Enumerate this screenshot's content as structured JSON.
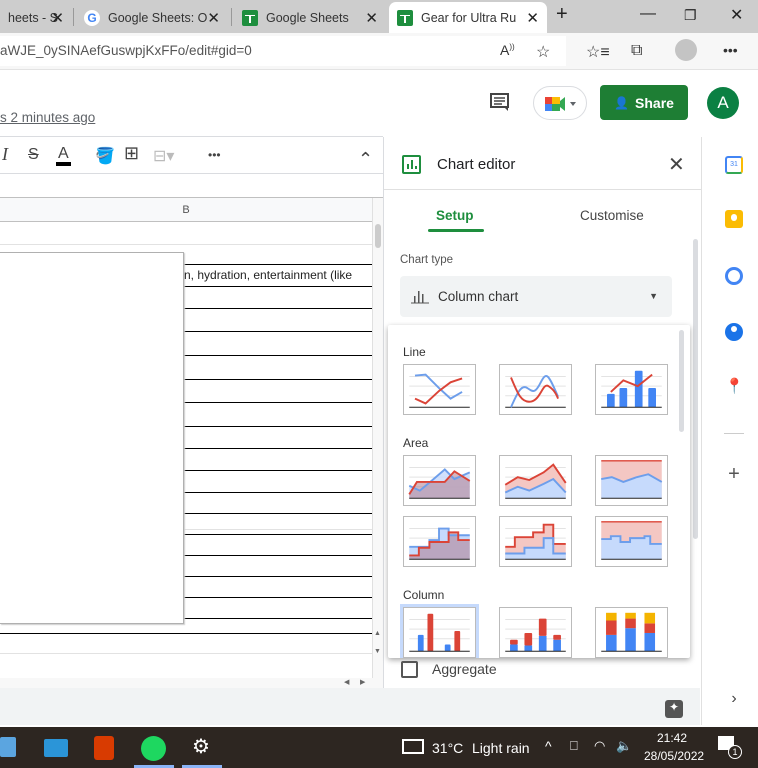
{
  "browser": {
    "tabs": [
      {
        "title": "heets - S",
        "favicon": "sheets-icon",
        "active": false
      },
      {
        "title": "Google Sheets: O",
        "favicon": "google-icon",
        "active": false
      },
      {
        "title": "Google Sheets",
        "favicon": "sheets-icon",
        "active": false
      },
      {
        "title": "Gear for Ultra Ru",
        "favicon": "sheets-icon",
        "active": true
      }
    ],
    "new_tab": "+",
    "url": "aWJE_0ySINAefGuswpjKxFFo/edit#gid=0",
    "window_controls": {
      "minimize": "—",
      "restore": "❐",
      "close": "✕"
    }
  },
  "sheets": {
    "last_edit": "s 2 minutes ago",
    "share_label": "Share",
    "avatar_letter": "A",
    "column_header": "B",
    "cell_text": "n, hydration, entertainment (like",
    "toolbar": {
      "italic": "I",
      "strike": "S",
      "text_color": "A",
      "more": "•••",
      "collapse": "⌃"
    }
  },
  "chart_editor": {
    "title": "Chart editor",
    "tabs": [
      {
        "label": "Setup",
        "active": true
      },
      {
        "label": "Customise",
        "active": false
      }
    ],
    "chart_type_label": "Chart type",
    "chart_type_value": "Column chart",
    "sections": [
      {
        "name": "Line",
        "types": [
          "line-chart",
          "smooth-line-chart",
          "combo-chart"
        ]
      },
      {
        "name": "Area",
        "types": [
          "area-chart",
          "stacked-area-chart",
          "100-stacked-area-chart",
          "stepped-area-chart",
          "stacked-stepped-area-chart",
          "100-stacked-stepped-area-chart"
        ]
      },
      {
        "name": "Column",
        "types": [
          "column-chart",
          "stacked-column-chart",
          "100-stacked-column-chart"
        ],
        "selected": "column-chart"
      }
    ],
    "aggregate_label": "Aggregate",
    "aggregate_checked": false
  },
  "colors": {
    "red": "#db4437",
    "blue": "#4285f4",
    "yellow": "#f4b400",
    "green": "#1e8e3e"
  },
  "taskbar": {
    "weather_temp": "31°C",
    "weather_desc": "Light rain",
    "time": "21:42",
    "date": "28/05/2022",
    "notification_count": "1"
  }
}
